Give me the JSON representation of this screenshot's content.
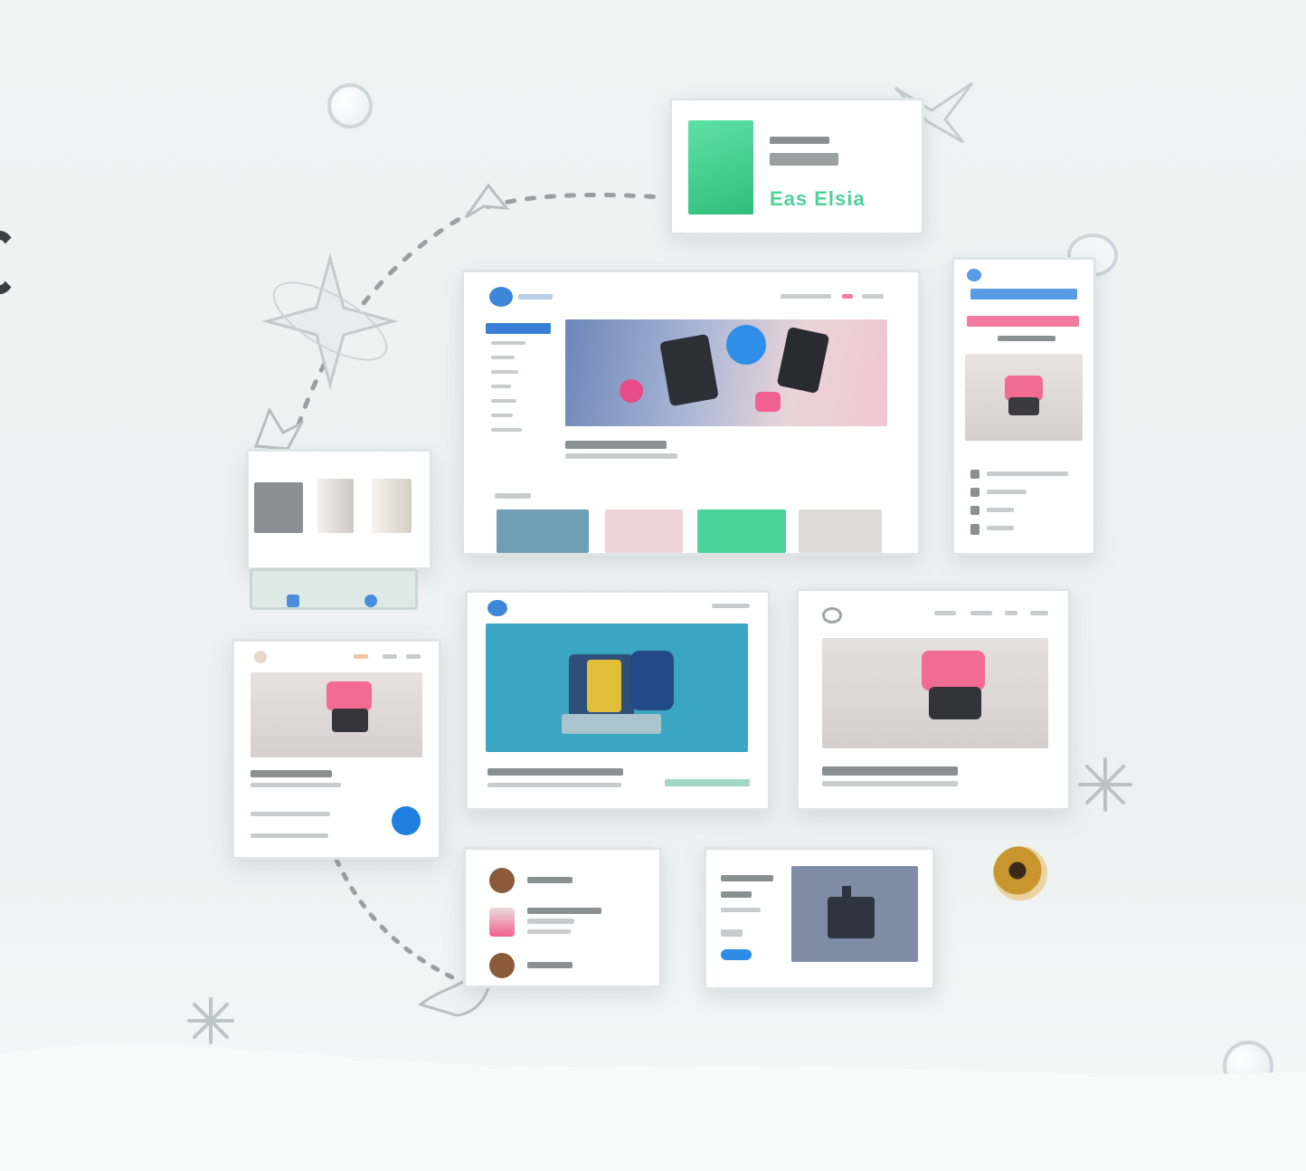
{
  "canvas": {
    "background": "#eff2f2"
  },
  "cards": {
    "green_card": {
      "price_text": "Eas Elsia",
      "accent": "#3fd18b"
    },
    "mobile_card": {
      "accent_blue": "#5a9be6",
      "accent_pink": "#f27aa0"
    },
    "product_detail": {
      "button_color": "#1f7fe0"
    },
    "promo": {
      "button_color": "#2e8be6"
    }
  },
  "icons": [
    "leaf-icon",
    "sparkle-icon",
    "snowflake-icon",
    "cookie-icon",
    "bubble-icon"
  ]
}
